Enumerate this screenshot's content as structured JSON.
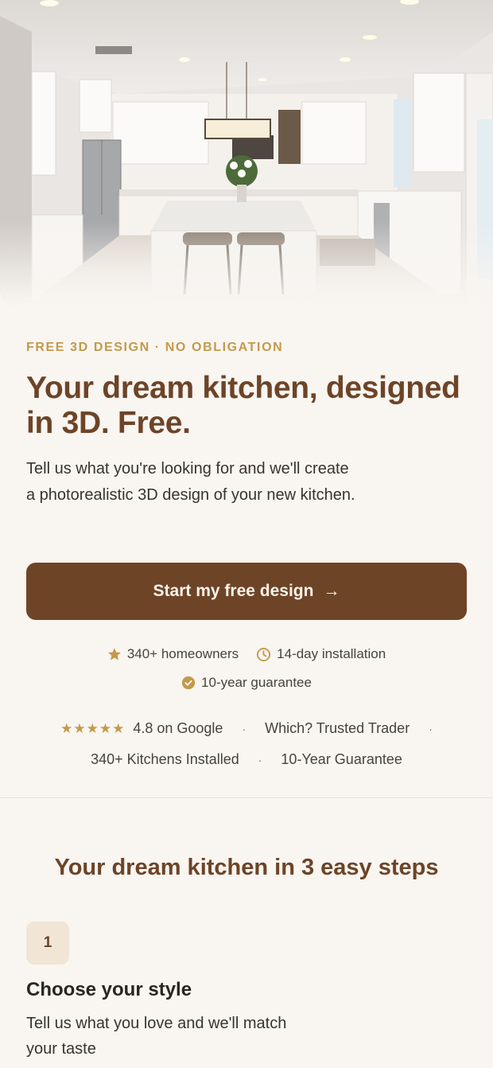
{
  "hero": {
    "image": "kitchen-photo",
    "alt_description_icon": "kitchen-image"
  },
  "eyebrow": "FREE 3D DESIGN · NO OBLIGATION",
  "headline": "Your dream kitchen, designed in 3D. Free.",
  "subtext": "Tell us what you're looking for and we'll create a photorealistic 3D design of your new kitchen.",
  "cta": {
    "label": "Start my free design",
    "arrow": "→"
  },
  "badges": [
    {
      "icon": "star-icon",
      "label": "340+ homeowners"
    },
    {
      "icon": "clock-icon",
      "label": "14-day installation"
    },
    {
      "icon": "check-circle-icon",
      "label": "10-year guarantee"
    }
  ],
  "trust": {
    "stars": "★★★★★",
    "google": "4.8 on Google",
    "which": "Which? Trusted Trader",
    "kitchens": "340+ Kitchens Installed",
    "guarantee": "10-Year Guarantee",
    "separator": "·"
  },
  "steps_section": {
    "title": "Your dream kitchen in 3 easy steps",
    "steps": [
      {
        "number": "1",
        "title": "Choose your style",
        "description": "Tell us what you love and we'll match your taste"
      }
    ]
  },
  "colors": {
    "brand": "#6e4427",
    "accent_gold": "#c39a4b",
    "background": "#f9f5f1"
  }
}
